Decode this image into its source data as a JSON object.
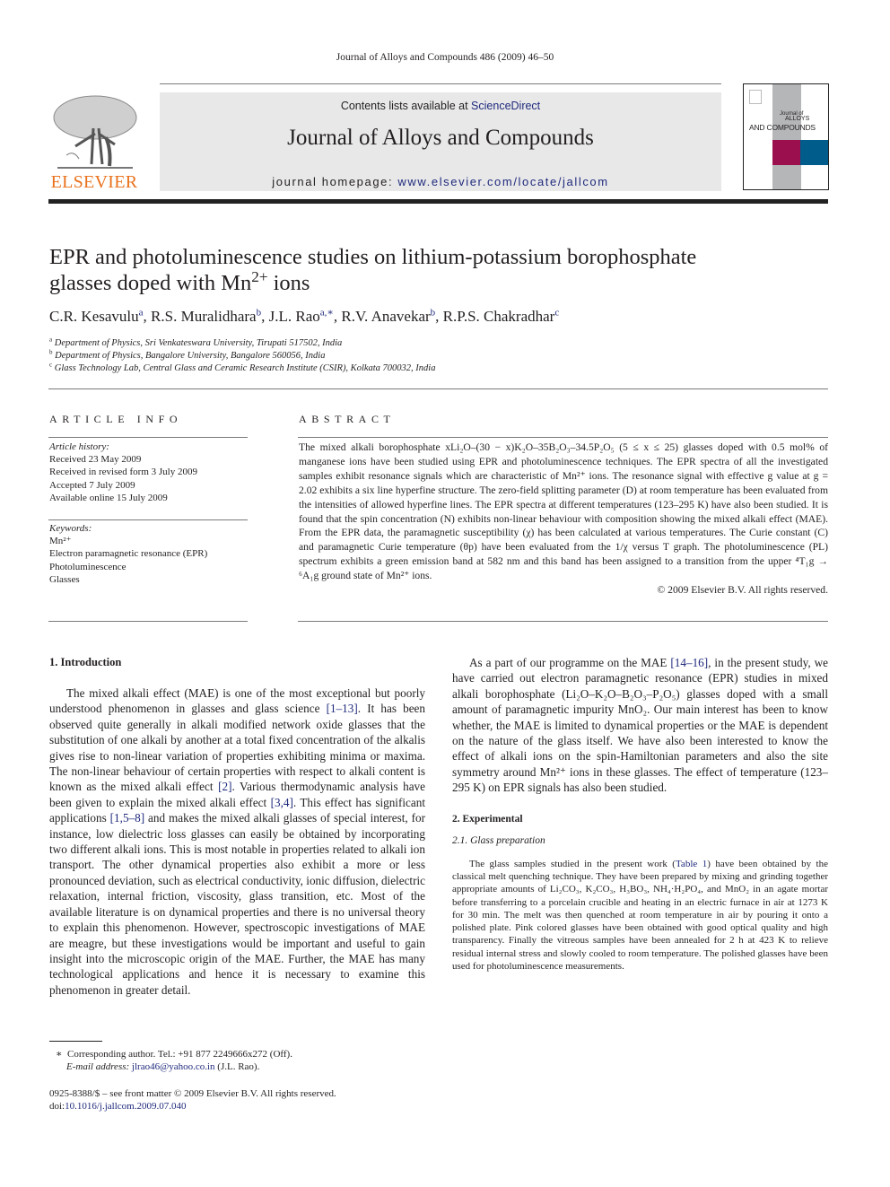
{
  "running_head": "Journal of Alloys and Compounds 486 (2009) 46–50",
  "masthead": {
    "contents_prefix": "Contents lists available at ",
    "contents_link": "ScienceDirect",
    "journal_title": "Journal of Alloys and Compounds",
    "homepage_prefix": "journal homepage: ",
    "homepage_link": "www.elsevier.com/locate/jallcom",
    "publisher_logo": "ELSEVIER",
    "cover": {
      "line1": "Journal of",
      "line2": "ALLOYS",
      "line3": "AND COMPOUNDS",
      "colors": {
        "stripe": "#b5b6b8",
        "red": "#9c0f4e",
        "blue": "#005c8a"
      }
    }
  },
  "article": {
    "title_line1": "EPR and photoluminescence studies on lithium-potassium borophosphate",
    "title_line2_prefix": "glasses doped with Mn",
    "title_line2_sup": "2+",
    "title_line2_suffix": " ions",
    "authors": [
      {
        "name": "C.R. Kesavulu",
        "affil": "a"
      },
      {
        "name": "R.S. Muralidhara",
        "affil": "b"
      },
      {
        "name": "J.L. Rao",
        "affil": "a,∗"
      },
      {
        "name": "R.V. Anavekar",
        "affil": "b"
      },
      {
        "name": "R.P.S. Chakradhar",
        "affil": "c"
      }
    ],
    "affiliations": [
      {
        "mark": "a",
        "text": "Department of Physics, Sri Venkateswara University, Tirupati 517502, India"
      },
      {
        "mark": "b",
        "text": "Department of Physics, Bangalore University, Bangalore 560056, India"
      },
      {
        "mark": "c",
        "text": "Glass Technology Lab, Central Glass and Ceramic Research Institute (CSIR), Kolkata 700032, India"
      }
    ]
  },
  "article_info": {
    "label": "ARTICLE INFO",
    "history_label": "Article history:",
    "history": [
      "Received 23 May 2009",
      "Received in revised form 3 July 2009",
      "Accepted 7 July 2009",
      "Available online 15 July 2009"
    ],
    "keywords_label": "Keywords:",
    "keywords": [
      "Mn²⁺",
      "Electron paramagnetic resonance (EPR)",
      "Photoluminescence",
      "Glasses"
    ]
  },
  "abstract": {
    "label": "ABSTRACT",
    "text": "The mixed alkali borophosphate xLi₂O–(30 − x)K₂O–35B₂O₃–34.5P₂O₅ (5 ≤ x ≤ 25) glasses doped with 0.5 mol% of manganese ions have been studied using EPR and photoluminescence techniques. The EPR spectra of all the investigated samples exhibit resonance signals which are characteristic of Mn²⁺ ions. The resonance signal with effective g value at g = 2.02 exhibits a six line hyperfine structure. The zero-field splitting parameter (D) at room temperature has been evaluated from the intensities of allowed hyperfine lines. The EPR spectra at different temperatures (123–295 K) have also been studied. It is found that the spin concentration (N) exhibits non-linear behaviour with composition showing the mixed alkali effect (MAE). From the EPR data, the paramagnetic susceptibility (χ) has been calculated at various temperatures. The Curie constant (C) and paramagnetic Curie temperature (θp) have been evaluated from the 1/χ versus T graph. The photoluminescence (PL) spectrum exhibits a green emission band at 582 nm and this band has been assigned to a transition from the upper ⁴T₁g → ⁶A₁g ground state of Mn²⁺ ions.",
    "copyright": "© 2009 Elsevier B.V. All rights reserved."
  },
  "introduction": {
    "heading": "1.  Introduction",
    "p1_segments": [
      {
        "t": "The mixed alkali effect (MAE) is one of the most exceptional but poorly understood phenomenon in glasses and glass science "
      },
      {
        "t": "[1–13]",
        "link": true
      },
      {
        "t": ". It has been observed quite generally in alkali modified network oxide glasses that the substitution of one alkali by another at a total fixed concentration of the alkalis gives rise to non-linear variation of properties exhibiting minima or maxima. The non-linear behaviour of certain properties with respect to alkali content is known as the mixed alkali effect "
      },
      {
        "t": "[2]",
        "link": true
      },
      {
        "t": ". Various thermodynamic analysis have been given to explain the mixed alkali effect "
      },
      {
        "t": "[3,4]",
        "link": true
      },
      {
        "t": ". This effect has significant applications "
      },
      {
        "t": "[1,5–8]",
        "link": true
      },
      {
        "t": " and makes the mixed alkali glasses of special interest, for instance, low dielectric loss glasses can easily be obtained by incorporating two different alkali ions. This is most notable in properties related to alkali ion transport. The other dynamical properties also exhibit a more or less pronounced deviation, such as electrical conductivity, ionic diffusion, dielectric relaxation, internal friction, viscosity, glass transition, etc. Most of the available literature is on dynamical properties and there is no universal theory to explain this phenomenon. However, spectroscopic investigations of MAE are meagre, but these investigations would be important and useful to gain insight into the microscopic origin of the MAE. Further, the MAE has many technological applications and hence it is necessary to examine this phenomenon in greater detail."
      }
    ],
    "p2_segments": [
      {
        "t": "As a part of our programme on the MAE "
      },
      {
        "t": "[14–16]",
        "link": true
      },
      {
        "t": ", in the present study, we have carried out electron paramagnetic resonance (EPR) studies in mixed alkali borophosphate (Li₂O–K₂O–B₂O₃–P₂O₅) glasses doped with a small amount of paramagnetic impurity MnO₂. Our main interest has been to know whether, the MAE is limited to dynamical properties or the MAE is dependent on the nature of the glass itself. We have also been interested to know the effect of alkali ions on the spin-Hamiltonian parameters and also the site symmetry around Mn²⁺ ions in these glasses. The effect of temperature (123–295 K) on EPR signals has also been studied."
      }
    ]
  },
  "experimental": {
    "heading": "2.  Experimental",
    "subheading": "2.1.   Glass preparation",
    "p1_segments": [
      {
        "t": "The glass samples studied in the present work ("
      },
      {
        "t": "Table 1",
        "link": true
      },
      {
        "t": ") have been obtained by the classical melt quenching technique. They have been prepared by mixing and grinding together appropriate amounts of Li₂CO₃, K₂CO₃, H₃BO₃, NH₄·H₂PO₄, and MnO₂ in an agate mortar before transferring to a porcelain crucible and heating in an electric furnace in air at 1273 K for 30 min. The melt was then quenched at room temperature in air by pouring it onto a polished plate. Pink colored glasses have been obtained with good optical quality and high transparency. Finally the vitreous samples have been annealed for 2 h at 423 K to relieve residual internal stress and slowly cooled to room temperature. The polished glasses have been used for photoluminescence measurements."
      }
    ]
  },
  "footnote": {
    "mark": "∗",
    "text": "Corresponding author. Tel.: +91 877 2249666x272 (Off).",
    "email_label": "E-mail address: ",
    "email": "jlrao46@yahoo.co.in",
    "email_suffix": " (J.L. Rao)."
  },
  "front_matter": {
    "issn_line": "0925-8388/$ – see front matter © 2009 Elsevier B.V. All rights reserved.",
    "doi_prefix": "doi:",
    "doi": "10.1016/j.jallcom.2009.07.040"
  }
}
